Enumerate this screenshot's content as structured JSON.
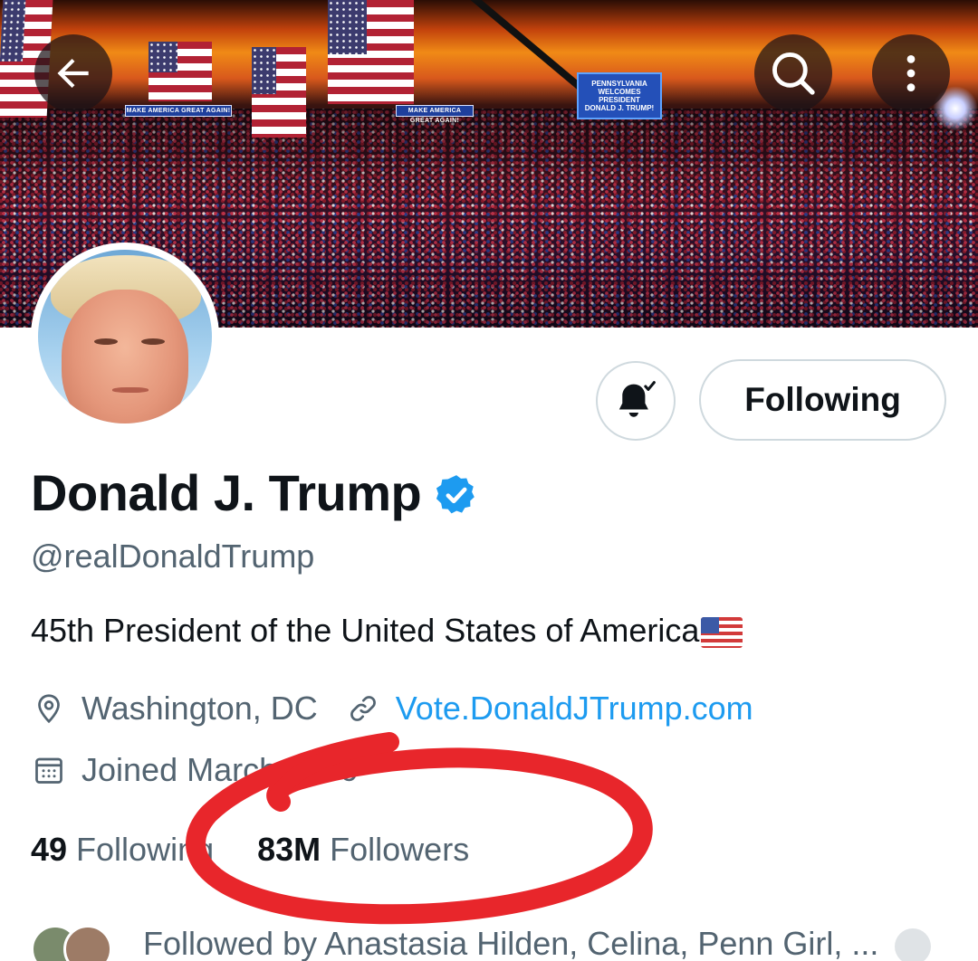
{
  "header": {
    "back_icon": "arrow-left-icon",
    "search_icon": "search-icon",
    "more_icon": "more-vertical-icon"
  },
  "banner": {
    "sign_left": "MAKE AMERICA GREAT AGAIN!",
    "sign_right": "MAKE AMERICA GREAT AGAIN!",
    "screen_lines": [
      "PENNSYLVANIA",
      "WELCOMES",
      "PRESIDENT",
      "DONALD J. TRUMP!"
    ]
  },
  "actions": {
    "bell_icon": "bell-checked-icon",
    "following_label": "Following"
  },
  "profile": {
    "display_name": "Donald J. Trump",
    "verified_icon": "verified-badge-icon",
    "handle": "@realDonaldTrump",
    "bio": "45th President of the United States of America",
    "bio_emoji": "us-flag-emoji",
    "location_icon": "location-pin-icon",
    "location": "Washington, DC",
    "link_icon": "link-icon",
    "website": "Vote.DonaldJTrump.com",
    "calendar_icon": "calendar-icon",
    "joined": "Joined March 2009"
  },
  "stats": {
    "following_count": "49",
    "following_label": "Following",
    "followers_count": "83M",
    "followers_label": "Followers"
  },
  "followed_by": {
    "text": "Followed by Anastasia Hilden, Celina, Penn Girl, ..."
  },
  "colors": {
    "accent": "#1d9bf0",
    "text_primary": "#0f1419",
    "text_secondary": "#536471",
    "annotation": "#e8262b"
  }
}
